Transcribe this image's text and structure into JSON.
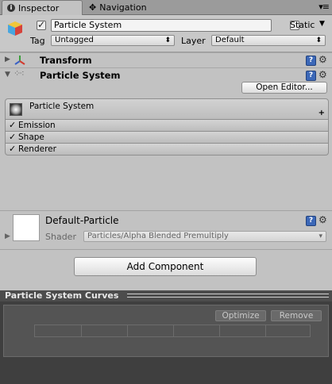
{
  "tabs": {
    "inspector": "Inspector",
    "navigation": "Navigation",
    "menu": "▾≡"
  },
  "header": {
    "name": "Particle System",
    "static_label": "Static",
    "tag_label": "Tag",
    "tag_value": "Untagged",
    "layer_label": "Layer",
    "layer_value": "Default"
  },
  "components": {
    "transform": "Transform",
    "particle_system": "Particle System",
    "open_editor": "Open Editor...",
    "modules_main": "Particle System",
    "modules_add": "+",
    "modules": [
      "Emission",
      "Shape",
      "Renderer"
    ]
  },
  "material": {
    "name": "Default-Particle",
    "shader_label": "Shader",
    "shader_value": "Particles/Alpha Blended Premultiply"
  },
  "add_component": "Add Component",
  "curves": {
    "title": "Particle System Curves",
    "optimize": "Optimize",
    "remove": "Remove"
  },
  "colors": {
    "accent": "#3c68b8",
    "panel": "#c2c2c2",
    "curves_bg": "#3f3f3f"
  }
}
